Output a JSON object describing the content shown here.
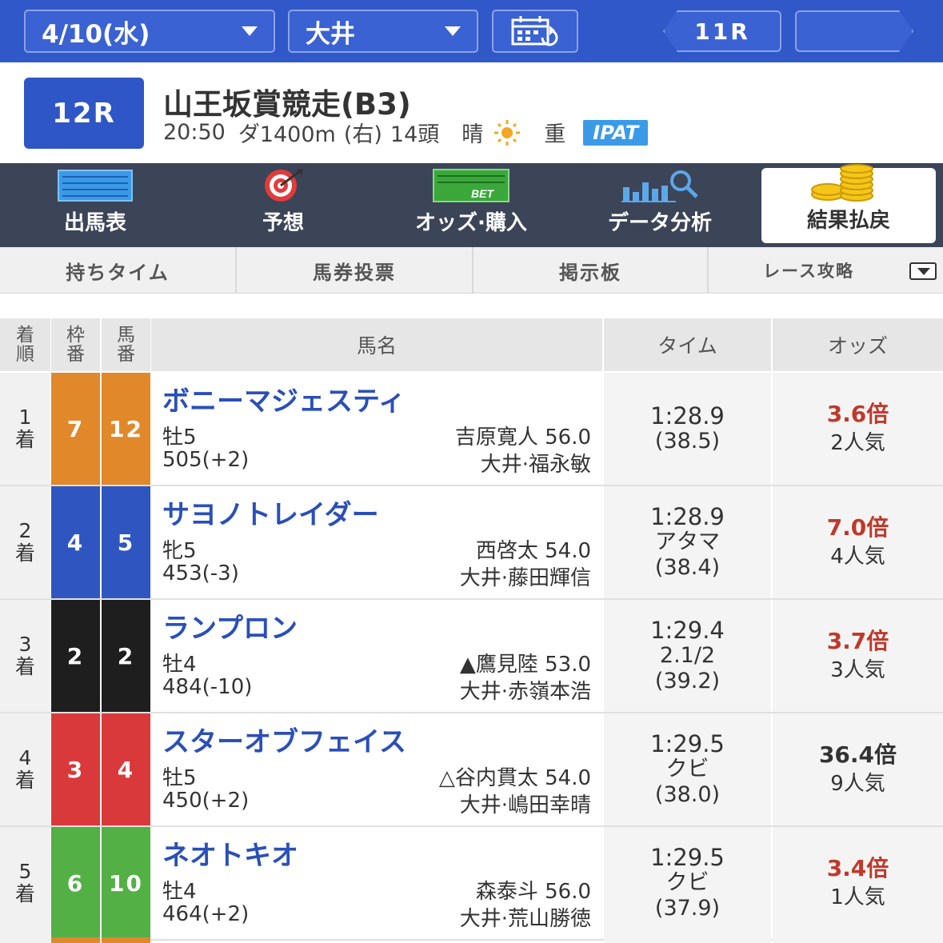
{
  "topbar": {
    "date": "4/10(水)",
    "venue": "大井",
    "prev_race": "11R",
    "next_race": ""
  },
  "race": {
    "number": "12R",
    "title": "山王坂賞競走(B3)",
    "time": "20:50",
    "course": "ダ1400m",
    "direction": "(右)",
    "runners": "14頭",
    "weather": "晴",
    "weather_icon": "sun-icon",
    "track": "重",
    "ipat": "IPAT"
  },
  "main_nav": [
    {
      "label": "出馬表",
      "icon": "race-card-icon"
    },
    {
      "label": "予想",
      "icon": "target-icon"
    },
    {
      "label": "オッズ·購入",
      "icon": "bet-icon"
    },
    {
      "label": "データ分析",
      "icon": "chart-search-icon"
    },
    {
      "label": "結果払戻",
      "icon": "coins-icon"
    }
  ],
  "sub_nav": [
    "持ちタイム",
    "馬券投票",
    "掲示板",
    "レース攻略"
  ],
  "table": {
    "headers": {
      "rank": [
        "着",
        "順"
      ],
      "waku": [
        "枠",
        "番"
      ],
      "uma": [
        "馬",
        "番"
      ],
      "horse": "馬名",
      "time": "タイム",
      "odds": "オッズ"
    },
    "rows": [
      {
        "rank": "1",
        "rank_suffix": "着",
        "waku": "7",
        "uma": "12",
        "color": "#e0882a",
        "name": "ボニーマジェスティ",
        "sex": "牡5",
        "weight": "505(+2)",
        "jockey": "吉原寛人 56.0",
        "trainer": "大井·福永敏",
        "time": "1:28.9",
        "margin": "",
        "last": "(38.5)",
        "odds": "3.6倍",
        "odds_color": "#c0392b",
        "pop": "2人気"
      },
      {
        "rank": "2",
        "rank_suffix": "着",
        "waku": "4",
        "uma": "5",
        "color": "#2f56c0",
        "name": "サヨノトレイダー",
        "sex": "牝5",
        "weight": "453(-3)",
        "jockey": "西啓太 54.0",
        "trainer": "大井·藤田輝信",
        "time": "1:28.9",
        "margin": "アタマ",
        "last": "(38.4)",
        "odds": "7.0倍",
        "odds_color": "#c0392b",
        "pop": "4人気"
      },
      {
        "rank": "3",
        "rank_suffix": "着",
        "waku": "2",
        "uma": "2",
        "color": "#1e1e1e",
        "name": "ランプロン",
        "sex": "牡4",
        "weight": "484(-10)",
        "jockey": "▲鷹見陸 53.0",
        "trainer": "大井·赤嶺本浩",
        "time": "1:29.4",
        "margin": "2.1/2",
        "last": "(39.2)",
        "odds": "3.7倍",
        "odds_color": "#c0392b",
        "pop": "3人気"
      },
      {
        "rank": "4",
        "rank_suffix": "着",
        "waku": "3",
        "uma": "4",
        "color": "#d9393a",
        "name": "スターオブフェイス",
        "sex": "牡5",
        "weight": "450(+2)",
        "jockey": "△谷内貫太 54.0",
        "trainer": "大井·嶋田幸晴",
        "time": "1:29.5",
        "margin": "クビ",
        "last": "(38.0)",
        "odds": "36.4倍",
        "odds_color": "#333333",
        "pop": "9人気"
      },
      {
        "rank": "5",
        "rank_suffix": "着",
        "waku": "6",
        "uma": "10",
        "color": "#52b044",
        "name": "ネオトキオ",
        "sex": "牡4",
        "weight": "464(+2)",
        "jockey": "森泰斗 56.0",
        "trainer": "大井·荒山勝徳",
        "time": "1:29.5",
        "margin": "クビ",
        "last": "(37.9)",
        "odds": "3.4倍",
        "odds_color": "#c0392b",
        "pop": "1人気"
      }
    ]
  }
}
